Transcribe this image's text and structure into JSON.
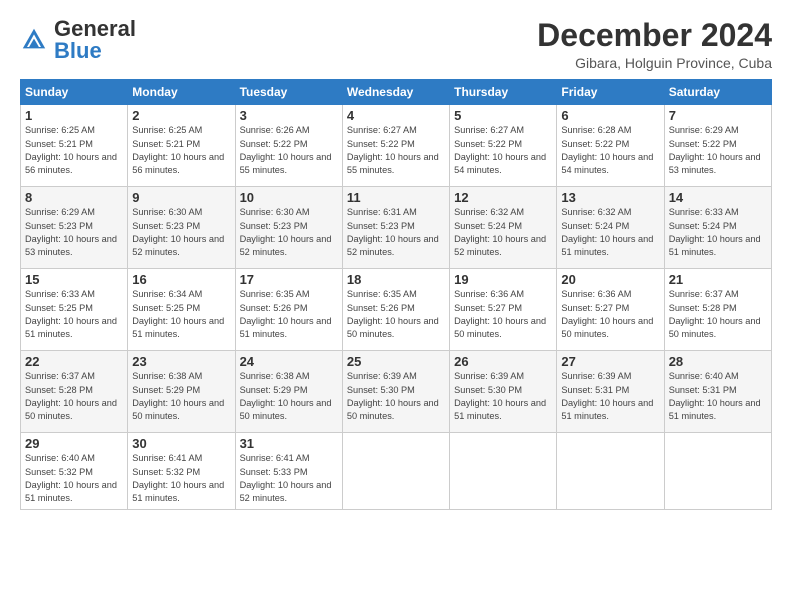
{
  "header": {
    "logo": {
      "general": "General",
      "blue": "Blue"
    },
    "title": "December 2024",
    "subtitle": "Gibara, Holguin Province, Cuba"
  },
  "calendar": {
    "days_of_week": [
      "Sunday",
      "Monday",
      "Tuesday",
      "Wednesday",
      "Thursday",
      "Friday",
      "Saturday"
    ],
    "weeks": [
      [
        null,
        null,
        null,
        null,
        {
          "day": "1",
          "sunrise": "6:25 AM",
          "sunset": "5:21 PM",
          "daylight": "10 hours and 56 minutes."
        },
        {
          "day": "2",
          "sunrise": "6:25 AM",
          "sunset": "5:21 PM",
          "daylight": "10 hours and 56 minutes."
        },
        {
          "day": "3",
          "sunrise": "6:26 AM",
          "sunset": "5:22 PM",
          "daylight": "10 hours and 55 minutes."
        },
        {
          "day": "4",
          "sunrise": "6:27 AM",
          "sunset": "5:22 PM",
          "daylight": "10 hours and 55 minutes."
        },
        {
          "day": "5",
          "sunrise": "6:27 AM",
          "sunset": "5:22 PM",
          "daylight": "10 hours and 54 minutes."
        },
        {
          "day": "6",
          "sunrise": "6:28 AM",
          "sunset": "5:22 PM",
          "daylight": "10 hours and 54 minutes."
        },
        {
          "day": "7",
          "sunrise": "6:29 AM",
          "sunset": "5:22 PM",
          "daylight": "10 hours and 53 minutes."
        }
      ],
      [
        {
          "day": "8",
          "sunrise": "6:29 AM",
          "sunset": "5:23 PM",
          "daylight": "10 hours and 53 minutes."
        },
        {
          "day": "9",
          "sunrise": "6:30 AM",
          "sunset": "5:23 PM",
          "daylight": "10 hours and 52 minutes."
        },
        {
          "day": "10",
          "sunrise": "6:30 AM",
          "sunset": "5:23 PM",
          "daylight": "10 hours and 52 minutes."
        },
        {
          "day": "11",
          "sunrise": "6:31 AM",
          "sunset": "5:23 PM",
          "daylight": "10 hours and 52 minutes."
        },
        {
          "day": "12",
          "sunrise": "6:32 AM",
          "sunset": "5:24 PM",
          "daylight": "10 hours and 52 minutes."
        },
        {
          "day": "13",
          "sunrise": "6:32 AM",
          "sunset": "5:24 PM",
          "daylight": "10 hours and 51 minutes."
        },
        {
          "day": "14",
          "sunrise": "6:33 AM",
          "sunset": "5:24 PM",
          "daylight": "10 hours and 51 minutes."
        }
      ],
      [
        {
          "day": "15",
          "sunrise": "6:33 AM",
          "sunset": "5:25 PM",
          "daylight": "10 hours and 51 minutes."
        },
        {
          "day": "16",
          "sunrise": "6:34 AM",
          "sunset": "5:25 PM",
          "daylight": "10 hours and 51 minutes."
        },
        {
          "day": "17",
          "sunrise": "6:35 AM",
          "sunset": "5:26 PM",
          "daylight": "10 hours and 51 minutes."
        },
        {
          "day": "18",
          "sunrise": "6:35 AM",
          "sunset": "5:26 PM",
          "daylight": "10 hours and 50 minutes."
        },
        {
          "day": "19",
          "sunrise": "6:36 AM",
          "sunset": "5:27 PM",
          "daylight": "10 hours and 50 minutes."
        },
        {
          "day": "20",
          "sunrise": "6:36 AM",
          "sunset": "5:27 PM",
          "daylight": "10 hours and 50 minutes."
        },
        {
          "day": "21",
          "sunrise": "6:37 AM",
          "sunset": "5:28 PM",
          "daylight": "10 hours and 50 minutes."
        }
      ],
      [
        {
          "day": "22",
          "sunrise": "6:37 AM",
          "sunset": "5:28 PM",
          "daylight": "10 hours and 50 minutes."
        },
        {
          "day": "23",
          "sunrise": "6:38 AM",
          "sunset": "5:29 PM",
          "daylight": "10 hours and 50 minutes."
        },
        {
          "day": "24",
          "sunrise": "6:38 AM",
          "sunset": "5:29 PM",
          "daylight": "10 hours and 50 minutes."
        },
        {
          "day": "25",
          "sunrise": "6:39 AM",
          "sunset": "5:30 PM",
          "daylight": "10 hours and 50 minutes."
        },
        {
          "day": "26",
          "sunrise": "6:39 AM",
          "sunset": "5:30 PM",
          "daylight": "10 hours and 51 minutes."
        },
        {
          "day": "27",
          "sunrise": "6:39 AM",
          "sunset": "5:31 PM",
          "daylight": "10 hours and 51 minutes."
        },
        {
          "day": "28",
          "sunrise": "6:40 AM",
          "sunset": "5:31 PM",
          "daylight": "10 hours and 51 minutes."
        }
      ],
      [
        {
          "day": "29",
          "sunrise": "6:40 AM",
          "sunset": "5:32 PM",
          "daylight": "10 hours and 51 minutes."
        },
        {
          "day": "30",
          "sunrise": "6:41 AM",
          "sunset": "5:32 PM",
          "daylight": "10 hours and 51 minutes."
        },
        {
          "day": "31",
          "sunrise": "6:41 AM",
          "sunset": "5:33 PM",
          "daylight": "10 hours and 52 minutes."
        },
        null,
        null,
        null,
        null
      ]
    ]
  }
}
